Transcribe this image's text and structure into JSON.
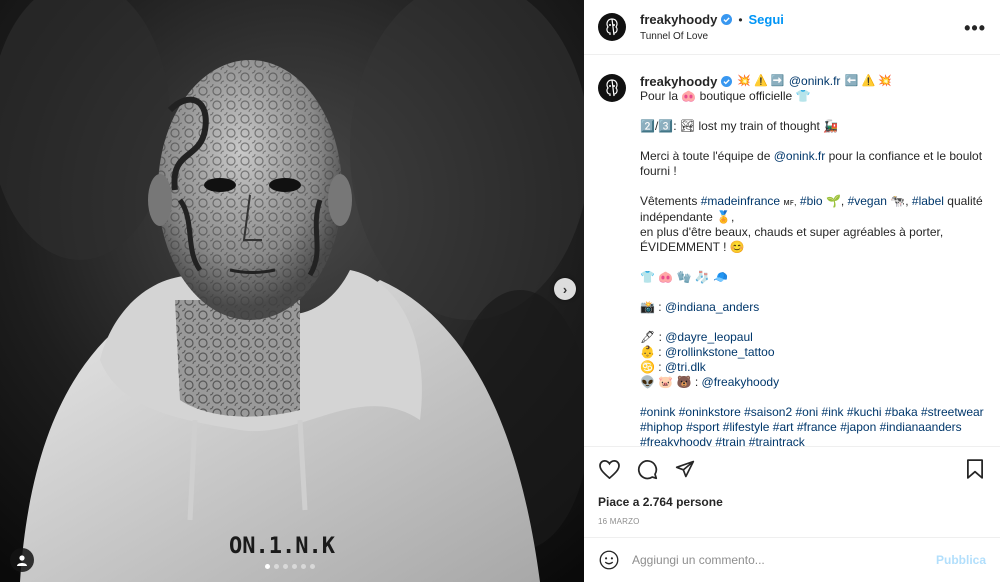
{
  "post": {
    "username": "freakyhoody",
    "follow_label": "Segui",
    "separator": "•",
    "location": "Tunnel Of Love",
    "more_label": "•••",
    "media": {
      "slide_count": 6,
      "active_slide": 1,
      "next_label": "›",
      "hoodie_text": "ON.1.N.K"
    }
  },
  "caption": {
    "username": "freakyhoody",
    "head_suffix": "💥 ⚠️ ➡️",
    "head_mention": "@onink.fr",
    "head_tail": "⬅️ ⚠️ 💥",
    "line1_pre": "Pour la",
    "line1_emoji": "🐽",
    "line1_post": "boutique officielle 👕",
    "line2": "2️⃣/3️⃣: 🏞 lost my train of thought 🚂",
    "line3_pre": "Merci à toute l'équipe de",
    "line3_mention": "@onink.fr",
    "line3_post": "pour la confiance et le boulot fourni !",
    "line4_pre": "Vêtements",
    "line4_tag1": "#madeinfrance",
    "line4_mf": "ᴍꜰ,",
    "line4_tag2": "#bio",
    "line4_e1": "🌱,",
    "line4_tag3": "#vegan",
    "line4_e2": "🐄,",
    "line4_tag4": "#label",
    "line4_post": "qualité indépendante 🏅,",
    "line5": "en plus d'être beaux, chauds et super agréables à porter,",
    "line6": "ÉVIDEMMENT ! 😊",
    "line7": "👕 🐽 🧤 🧦 🧢",
    "photo_prefix": "📸 :",
    "photo_credit": "@indiana_anders",
    "credit1_prefix": "🖋 :",
    "credit1": "@dayre_leopaul",
    "credit2_prefix": "👶 :",
    "credit2": "@rollinkstone_tattoo",
    "credit3_prefix": "♋ :",
    "credit3": "@tri.dlk",
    "credit4_prefix": "👽 🐷 🐻 :",
    "credit4": "@freakyhoody",
    "hashtags": [
      "#onink",
      "#oninkstore",
      "#saison2",
      "#oni",
      "#ink",
      "#kuchi",
      "#baka",
      "#streetwear",
      "#hiphop",
      "#sport",
      "#lifestyle",
      "#art",
      "#france",
      "#japon",
      "#indianaanders",
      "#freakyhoody",
      "#train",
      "#traintrack"
    ]
  },
  "engagement": {
    "likes_text": "Piace a 2.764 persone",
    "date": "16 MARZO"
  },
  "comment": {
    "placeholder": "Aggiungi un commento...",
    "publish_label": "Pubblica"
  }
}
